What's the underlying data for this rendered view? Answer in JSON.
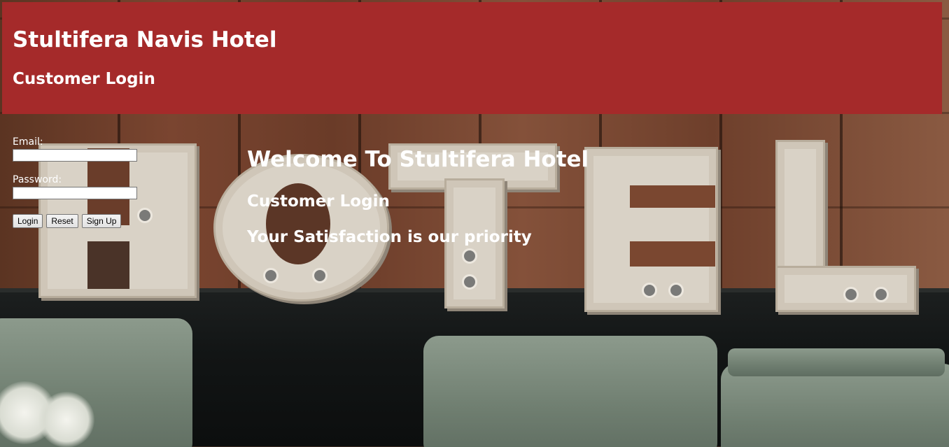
{
  "header": {
    "title": "Stultifera Navis Hotel",
    "subtitle": "Customer Login"
  },
  "login_form": {
    "email_label": "Email:",
    "email_value": "",
    "password_label": "Password:",
    "password_value": "",
    "buttons": {
      "login": "Login",
      "reset": "Reset",
      "signup": "Sign Up"
    }
  },
  "welcome": {
    "title": "Welcome To Stultifera Hotel",
    "subtitle": "Customer Login",
    "tagline": "Your Satisfaction is our priority"
  },
  "colors": {
    "header_background": "#a52a2a",
    "text": "#ffffff"
  }
}
